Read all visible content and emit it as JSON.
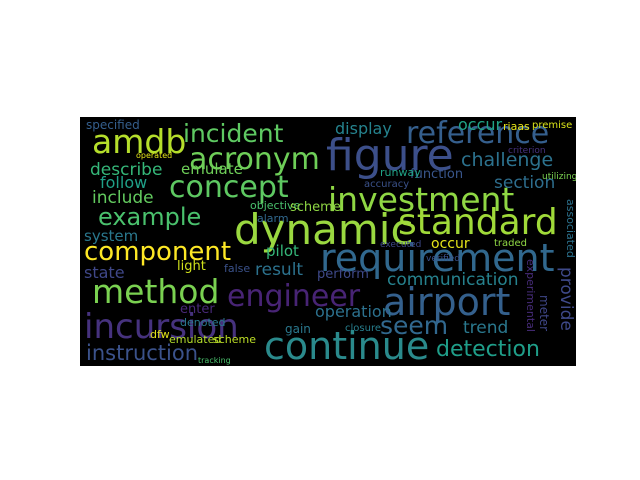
{
  "words": [
    {
      "text": "continue",
      "color": "#2a8a8c"
    },
    {
      "text": "dynamic",
      "color": "#9ad840"
    },
    {
      "text": "figure",
      "color": "#3c4f8a"
    },
    {
      "text": "investment",
      "color": "#8fd744"
    },
    {
      "text": "standard",
      "color": "#a0da39"
    },
    {
      "text": "requirement",
      "color": "#31688e"
    },
    {
      "text": "airport",
      "color": "#34608d"
    },
    {
      "text": "incursion",
      "color": "#46327e"
    },
    {
      "text": "method",
      "color": "#7ad151"
    },
    {
      "text": "concept",
      "color": "#5ec962"
    },
    {
      "text": "engineer",
      "color": "#482475"
    },
    {
      "text": "reference",
      "color": "#355f8d"
    },
    {
      "text": "component",
      "color": "#fde725"
    },
    {
      "text": "amdb",
      "color": "#b5de2b"
    },
    {
      "text": "acronym",
      "color": "#6ece58"
    },
    {
      "text": "incident",
      "color": "#5ec962"
    },
    {
      "text": "example",
      "color": "#4ac16d"
    },
    {
      "text": "seem",
      "color": "#31688e"
    },
    {
      "text": "detection",
      "color": "#1f9e89"
    },
    {
      "text": "instruction",
      "color": "#3b528b"
    },
    {
      "text": "communication",
      "color": "#26828e"
    },
    {
      "text": "challenge",
      "color": "#2c728e"
    },
    {
      "text": "section",
      "color": "#2e6e8e"
    },
    {
      "text": "display",
      "color": "#25838e"
    },
    {
      "text": "provide",
      "color": "#3e4989"
    },
    {
      "text": "operation",
      "color": "#2c718e"
    },
    {
      "text": "trend",
      "color": "#2a788e"
    },
    {
      "text": "include",
      "color": "#63cb5f"
    },
    {
      "text": "follow",
      "color": "#1fa088"
    },
    {
      "text": "describe",
      "color": "#35b779"
    },
    {
      "text": "system",
      "color": "#2a788e"
    },
    {
      "text": "state",
      "color": "#3f4788"
    },
    {
      "text": "result",
      "color": "#2c728e"
    },
    {
      "text": "pilot",
      "color": "#35b779"
    },
    {
      "text": "emulate",
      "color": "#6ece58"
    },
    {
      "text": "require",
      "color": "#39568c"
    },
    {
      "text": "function",
      "color": "#e5e419"
    },
    {
      "text": "occur",
      "color": "#20a386"
    },
    {
      "text": "specified",
      "color": "#355f8d"
    },
    {
      "text": "light",
      "color": "#d0e11c"
    },
    {
      "text": "alert",
      "color": "#8fd744"
    },
    {
      "text": "perform",
      "color": "#3e4989"
    },
    {
      "text": "enter",
      "color": "#482878"
    },
    {
      "text": "emulated",
      "color": "#b5de2b"
    },
    {
      "text": "scheme",
      "color": "#bddf26"
    },
    {
      "text": "alarm",
      "color": "#31688e"
    },
    {
      "text": "objective",
      "color": "#4ac16d"
    },
    {
      "text": "accuracy",
      "color": "#3b528b"
    },
    {
      "text": "experimental",
      "color": "#472c7a"
    },
    {
      "text": "associated",
      "color": "#2c728e"
    },
    {
      "text": "meter",
      "color": "#3f4788"
    },
    {
      "text": "runway",
      "color": "#20a386"
    },
    {
      "text": "gain",
      "color": "#2a788e"
    },
    {
      "text": "closure",
      "color": "#277f8e"
    },
    {
      "text": "traded",
      "color": "#8fd744"
    },
    {
      "text": "executed",
      "color": "#3e4989"
    },
    {
      "text": "denoted",
      "color": "#2a788e"
    },
    {
      "text": "dfw",
      "color": "#e2e418"
    },
    {
      "text": "false",
      "color": "#3b528b"
    },
    {
      "text": "riaas",
      "color": "#e5e419"
    },
    {
      "text": "premise",
      "color": "#d8e219"
    },
    {
      "text": "criterion",
      "color": "#46327e"
    },
    {
      "text": "utilizing",
      "color": "#7ad151"
    },
    {
      "text": "verified",
      "color": "#3b528b"
    },
    {
      "text": "tracking",
      "color": "#4ac16d"
    },
    {
      "text": "operated",
      "color": "#e5e419"
    }
  ]
}
